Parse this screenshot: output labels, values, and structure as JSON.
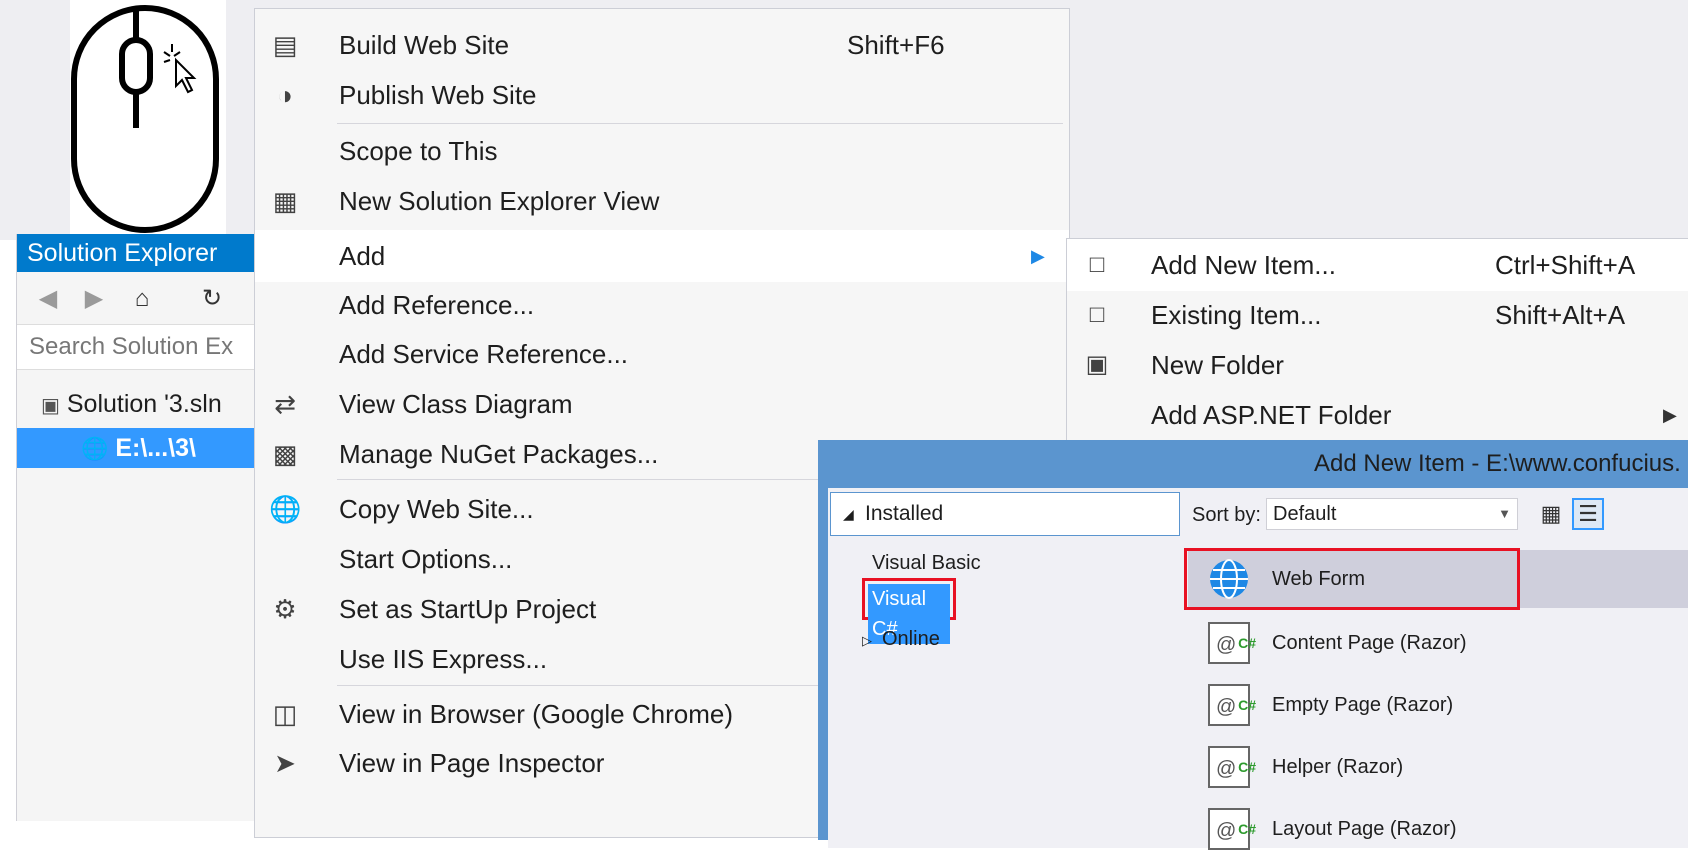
{
  "solution_explorer": {
    "title": "Solution Explorer",
    "search_placeholder": "Search Solution Ex",
    "tree": {
      "solution": "Solution '3.sln",
      "project": "E:\\...\\3\\"
    }
  },
  "context_menu": {
    "items": [
      {
        "label": "Build Web Site",
        "shortcut": "Shift+F6",
        "icon": "build-icon"
      },
      {
        "label": "Publish Web Site",
        "shortcut": "",
        "icon": "publish-icon"
      },
      {
        "label": "Scope to This",
        "shortcut": "",
        "icon": ""
      },
      {
        "label": "New Solution Explorer View",
        "shortcut": "",
        "icon": "new-view-icon"
      },
      {
        "label": "Add",
        "shortcut": "",
        "icon": "",
        "has_submenu": true
      },
      {
        "label": "Add Reference...",
        "shortcut": "",
        "icon": ""
      },
      {
        "label": "Add Service Reference...",
        "shortcut": "",
        "icon": ""
      },
      {
        "label": "View Class Diagram",
        "shortcut": "",
        "icon": "class-diagram-icon"
      },
      {
        "label": "Manage NuGet Packages...",
        "shortcut": "",
        "icon": "nuget-icon"
      },
      {
        "label": "Copy Web Site...",
        "shortcut": "",
        "icon": "copy-web-icon"
      },
      {
        "label": "Start Options...",
        "shortcut": "",
        "icon": ""
      },
      {
        "label": "Set as StartUp Project",
        "shortcut": "",
        "icon": "gear-icon"
      },
      {
        "label": "Use IIS Express...",
        "shortcut": "",
        "icon": ""
      },
      {
        "label": "View in Browser (Google Chrome)",
        "shortcut": "",
        "icon": "browser-icon"
      },
      {
        "label": "View in Page Inspector",
        "shortcut": "",
        "icon": "inspector-icon"
      }
    ]
  },
  "add_submenu": {
    "items": [
      {
        "label": "Add New Item...",
        "shortcut": "Ctrl+Shift+A",
        "icon": "new-item-icon"
      },
      {
        "label": "Existing Item...",
        "shortcut": "Shift+Alt+A",
        "icon": "existing-item-icon"
      },
      {
        "label": "New Folder",
        "shortcut": "",
        "icon": "new-folder-icon"
      },
      {
        "label": "Add ASP.NET Folder",
        "shortcut": "",
        "icon": "",
        "has_submenu": true
      }
    ]
  },
  "dialog": {
    "title": "Add New Item - E:\\www.confucius.",
    "tree": {
      "installed": "Installed",
      "languages": [
        "Visual Basic",
        "Visual C#"
      ],
      "online": "Online"
    },
    "sort_by_label": "Sort by:",
    "sort_by_value": "Default",
    "templates": [
      "Web Form",
      "Content Page (Razor)",
      "Empty Page (Razor)",
      "Helper (Razor)",
      "Layout Page (Razor)"
    ]
  },
  "colors": {
    "accent": "#007acc",
    "selection": "#3399ff",
    "dialog_frame": "#5b95cf",
    "highlight_box": "#e81123"
  }
}
